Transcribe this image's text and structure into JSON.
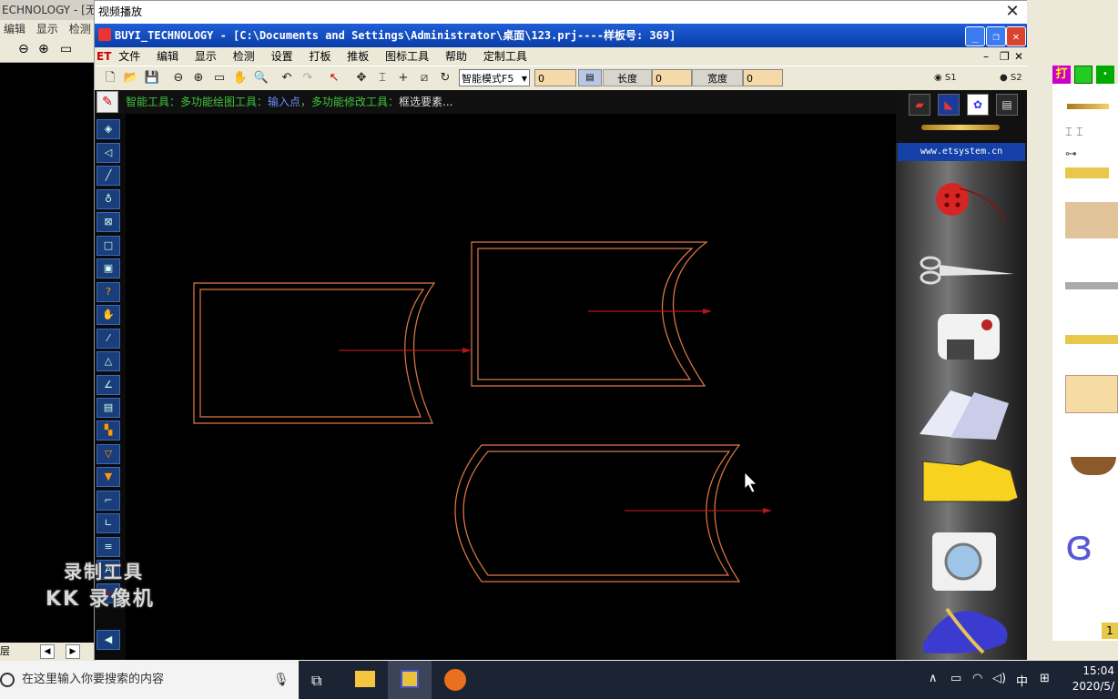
{
  "background_app": {
    "title": "ECHNOLOGY - [无",
    "menu": [
      "编辑",
      "显示",
      "检测"
    ],
    "status_left": "层"
  },
  "player": {
    "title": "视频播放"
  },
  "app": {
    "title": "BUYI_TECHNOLOGY - [C:\\Documents and Settings\\Administrator\\桌面\\123.prj----样板号: 369]",
    "logo": "ET",
    "menu": [
      "文件",
      "编辑",
      "显示",
      "检测",
      "设置",
      "打板",
      "推板",
      "图标工具",
      "帮助",
      "定制工具"
    ],
    "toolbar": {
      "mode_select": "智能模式F5",
      "field1": "0",
      "length_label": "长度",
      "length_value": "0",
      "width_label": "宽度",
      "width_value": "0",
      "radio_s1": "S1",
      "radio_s2": "S2"
    },
    "status": {
      "part1": "智能工具：多功能绘图工具：",
      "part2": "输入点",
      "part3": "，多功能修改工具：",
      "part4": "框选要素..."
    },
    "right_panel": {
      "url": "www.etsystem.cn",
      "items": [
        "button-thread",
        "scissors",
        "sewing-machine",
        "fabric-sheets",
        "pattern-piece",
        "washing-machine",
        "french-curve-ruler"
      ]
    }
  },
  "overlay": {
    "line1": "录制工具",
    "line2": "KK 录像机"
  },
  "taskbar": {
    "search_placeholder": "在这里输入你要搜索的内容",
    "time": "15:04",
    "date": "2020/5/",
    "ime": "中"
  },
  "far_right": {
    "tab_label": "打",
    "bottom_badge": "1"
  },
  "colors": {
    "pattern_outline": "#e07a45",
    "grain_arrow": "#b01818",
    "titlebar": "#0a3ea8",
    "status_green": "#3ec63e",
    "status_blue": "#6b8cff"
  }
}
